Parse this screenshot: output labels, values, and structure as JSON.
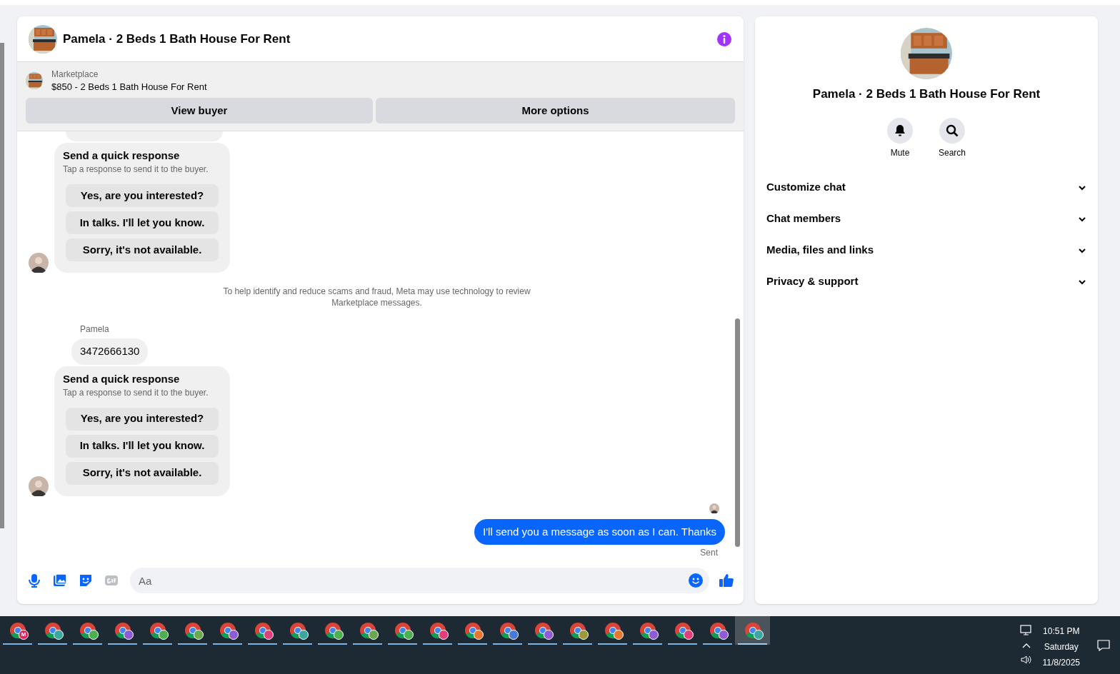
{
  "conversation": {
    "title": "Pamela · 2 Beds 1 Bath House For Rent"
  },
  "listing": {
    "source": "Marketplace",
    "title": "$850 - 2 Beds 1 Bath House For Rent",
    "actions": [
      "View buyer",
      "More options"
    ]
  },
  "messages": [
    {
      "kind": "partial"
    },
    {
      "kind": "quick_responses",
      "title": "Send a quick response",
      "subtitle": "Tap a response to send it to the buyer.",
      "options": [
        "Yes, are you interested?",
        "In talks. I'll let you know.",
        "Sorry, it's not available."
      ]
    },
    {
      "kind": "notice",
      "text": "To help identify and reduce scams and fraud, Meta may use technology to review Marketplace messages."
    },
    {
      "kind": "sender",
      "text": "Pamela"
    },
    {
      "kind": "incoming",
      "text": "3472666130"
    },
    {
      "kind": "quick_responses",
      "title": "Send a quick response",
      "subtitle": "Tap a response to send it to the buyer.",
      "options": [
        "Yes, are you interested?",
        "In talks. I'll let you know.",
        "Sorry, it's not available."
      ]
    },
    {
      "kind": "seen"
    },
    {
      "kind": "outgoing",
      "text": "I'll send you a message as soon as I can. Thanks",
      "status": "Sent"
    }
  ],
  "composer": {
    "placeholder": "Aa"
  },
  "details": {
    "title": "Pamela · 2 Beds 1 Bath House For Rent",
    "actions": [
      {
        "kind": "bell",
        "label": "Mute"
      },
      {
        "kind": "search",
        "label": "Search"
      }
    ],
    "sections": [
      {
        "label": "Customize chat",
        "expanded": false
      },
      {
        "label": "Chat members",
        "expanded": false
      },
      {
        "label": "Media, files and links",
        "expanded": false
      },
      {
        "label": "Privacy & support",
        "expanded": false
      }
    ]
  },
  "taskbar": {
    "apps": [
      {
        "color": "#e0245e",
        "badge": "M",
        "selected": false
      },
      {
        "color": "#3aa8a0",
        "selected": false
      },
      {
        "color": "#4caf50",
        "selected": false
      },
      {
        "color": "#8e5bd6",
        "selected": false
      },
      {
        "color": "#4caf50",
        "selected": false
      },
      {
        "color": "#6aa84f",
        "selected": false
      },
      {
        "color": "#8e5bd6",
        "selected": false
      },
      {
        "color": "#e0407a",
        "selected": false
      },
      {
        "color": "#3aa8a0",
        "selected": false
      },
      {
        "color": "#4caf50",
        "selected": false
      },
      {
        "color": "#6aa84f",
        "selected": false
      },
      {
        "color": "#4caf50",
        "selected": false
      },
      {
        "color": "#e0407a",
        "selected": false
      },
      {
        "color": "#e8772e",
        "selected": false
      },
      {
        "color": "#4a78d8",
        "selected": false
      },
      {
        "color": "#8e5bd6",
        "selected": false
      },
      {
        "color": "#9a9a3a",
        "selected": false
      },
      {
        "color": "#e8772e",
        "selected": false
      },
      {
        "color": "#8e5bd6",
        "selected": false
      },
      {
        "color": "#e0407a",
        "selected": false
      },
      {
        "color": "#8e5bd6",
        "selected": false
      },
      {
        "color": "#3aa8a0",
        "selected": true
      }
    ],
    "time": "10:51 PM",
    "day": "Saturday",
    "date": "11/8/2025"
  }
}
